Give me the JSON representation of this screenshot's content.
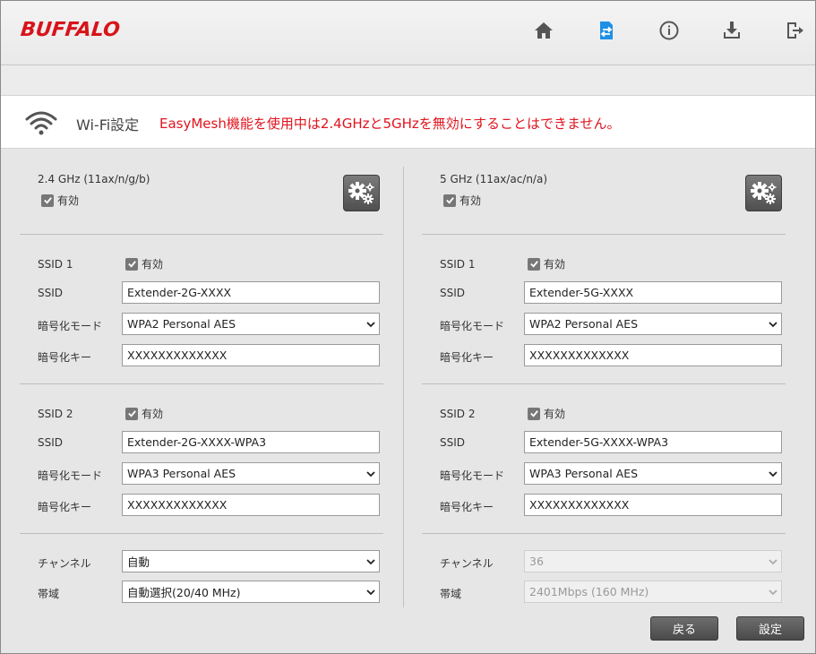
{
  "brand": {
    "logo_text": "BUFFALO",
    "logo_color": "#d7141a"
  },
  "nav": {
    "icons": [
      "home-icon",
      "wifi-settings-icon",
      "info-icon",
      "download-icon",
      "logout-icon"
    ],
    "active": "wifi-settings-icon",
    "active_color": "#1e90e6"
  },
  "page": {
    "title": "Wi-Fi設定",
    "warning": "EasyMesh機能を使用中は2.4GHzと5GHzを無効にすることはできません。",
    "warning_color": "#e0141e"
  },
  "bands": [
    {
      "band_label": "2.4 GHz (11ax/n/g/b)",
      "enabled_label": "有効",
      "ssid1": {
        "title": "SSID 1",
        "enabled_label": "有効",
        "ssid_label": "SSID",
        "ssid_value": "Extender-2G-XXXX",
        "mode_label": "暗号化モード",
        "mode_value": "WPA2 Personal AES",
        "key_label": "暗号化キー",
        "key_value": "XXXXXXXXXXXXX"
      },
      "ssid2": {
        "title": "SSID 2",
        "enabled_label": "有効",
        "ssid_label": "SSID",
        "ssid_value": "Extender-2G-XXXX-WPA3",
        "mode_label": "暗号化モード",
        "mode_value": "WPA3 Personal AES",
        "key_label": "暗号化キー",
        "key_value": "XXXXXXXXXXXXX"
      },
      "channel_label": "チャンネル",
      "channel_value": "自動",
      "bandwidth_label": "帯域",
      "bandwidth_value": "自動選択(20/40 MHz)"
    },
    {
      "band_label": "5 GHz (11ax/ac/n/a)",
      "enabled_label": "有効",
      "ssid1": {
        "title": "SSID 1",
        "enabled_label": "有効",
        "ssid_label": "SSID",
        "ssid_value": "Extender-5G-XXXX",
        "mode_label": "暗号化モード",
        "mode_value": "WPA2 Personal AES",
        "key_label": "暗号化キー",
        "key_value": "XXXXXXXXXXXXX"
      },
      "ssid2": {
        "title": "SSID 2",
        "enabled_label": "有効",
        "ssid_label": "SSID",
        "ssid_value": "Extender-5G-XXXX-WPA3",
        "mode_label": "暗号化モード",
        "mode_value": "WPA3 Personal AES",
        "key_label": "暗号化キー",
        "key_value": "XXXXXXXXXXXXX"
      },
      "channel_label": "チャンネル",
      "channel_value": "36",
      "bandwidth_label": "帯域",
      "bandwidth_value": "2401Mbps (160 MHz)"
    }
  ],
  "buttons": {
    "back": "戻る",
    "apply": "設定"
  }
}
